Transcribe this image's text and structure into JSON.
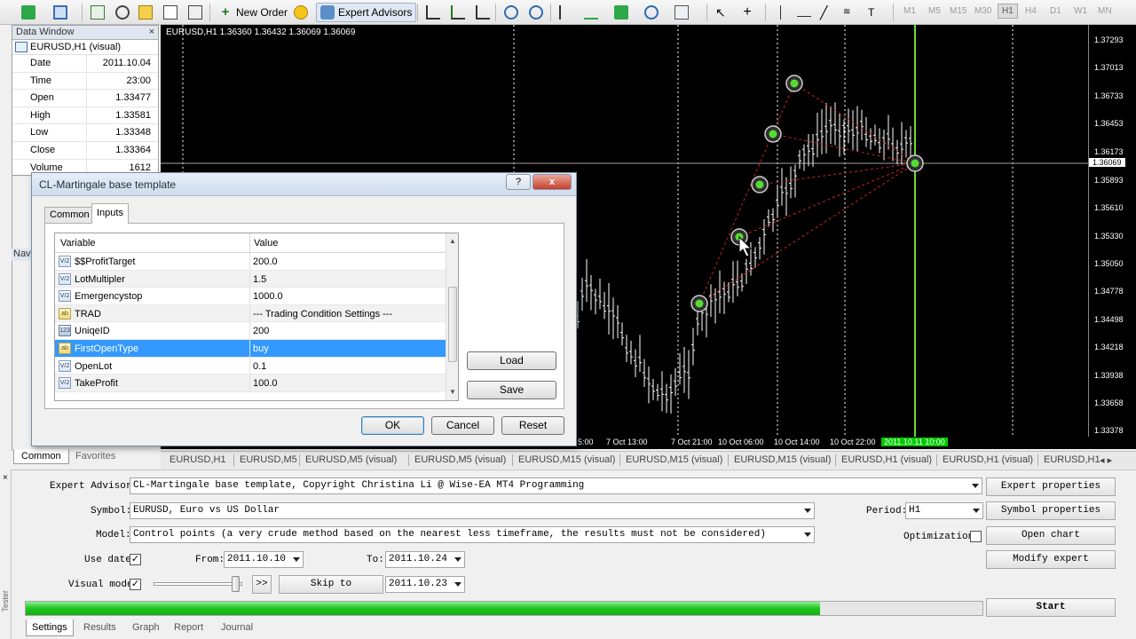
{
  "colors": {
    "chart_bg": "#000000",
    "candle": "#ffffff",
    "green_line": "#66dd33",
    "arrow_line": "#cc2222",
    "selection": "#3399ff",
    "progress": "#22c322"
  },
  "toolbar": {
    "new_order": "New Order",
    "expert_advisors": "Expert Advisors",
    "timeframes": [
      "M1",
      "M5",
      "M15",
      "M30",
      "H1",
      "H4",
      "D1",
      "W1",
      "MN"
    ],
    "active_timeframe": "H1"
  },
  "data_window": {
    "title": "Data Window",
    "close": "×",
    "symbol": "EURUSD,H1 (visual)",
    "rows": [
      {
        "k": "Date",
        "v": "2011.10.04"
      },
      {
        "k": "Time",
        "v": "23:00"
      },
      {
        "k": "Open",
        "v": "1.33477"
      },
      {
        "k": "High",
        "v": "1.33581"
      },
      {
        "k": "Low",
        "v": "1.33348"
      },
      {
        "k": "Close",
        "v": "1.33364"
      },
      {
        "k": "Volume",
        "v": "1612"
      }
    ],
    "navigator_stub": "Nav",
    "tabs": [
      "Common",
      "Favorites"
    ]
  },
  "chart": {
    "label": "EURUSD,H1  1.36360 1.36432 1.36069 1.36069",
    "price_labels": [
      "1.37293",
      "1.37013",
      "1.36733",
      "1.36453",
      "1.36173",
      "1.36069",
      "1.35893",
      "1.35610",
      "1.35330",
      "1.35050",
      "1.34778",
      "1.34498",
      "1.34218",
      "1.33938",
      "1.33658",
      "1.33378"
    ],
    "current_price": "1.36069",
    "time_labels": [
      "5:00",
      "7 Oct 13:00",
      "7 Oct 21:00",
      "10 Oct 06:00",
      "10 Oct 14:00",
      "10 Oct 22:00",
      "2011.10.11 10:00"
    ],
    "tabs": [
      "EURUSD,H1",
      "EURUSD,M5",
      "EURUSD,M5 (visual)",
      "EURUSD,M5 (visual)",
      "EURUSD,M15 (visual)",
      "EURUSD,M15 (visual)",
      "EURUSD,M15 (visual)",
      "EURUSD,H1 (visual)",
      "EURUSD,H1 (visual)",
      "EURUSD,H1"
    ]
  },
  "dialog": {
    "title": "CL-Martingale base template",
    "help_btn": "?",
    "close_btn": "x",
    "tabs": [
      "Common",
      "Inputs"
    ],
    "active_tab": "Inputs",
    "columns": [
      "Variable",
      "Value"
    ],
    "rows": [
      {
        "icon": "V/2",
        "type": "v",
        "name": "$$ProfitTarget",
        "value": "200.0"
      },
      {
        "icon": "V/2",
        "type": "v",
        "name": "LotMultipler",
        "value": "1.5"
      },
      {
        "icon": "V/2",
        "type": "v",
        "name": "Emergencystop",
        "value": "1000.0"
      },
      {
        "icon": "ab",
        "type": "ab",
        "name": "TRAD",
        "value": "--- Trading Condition Settings ---"
      },
      {
        "icon": "123",
        "type": "n",
        "name": "UniqeID",
        "value": "200"
      },
      {
        "icon": "ab",
        "type": "ab",
        "name": "FirstOpenType",
        "value": "buy",
        "selected": true
      },
      {
        "icon": "V/2",
        "type": "v",
        "name": "OpenLot",
        "value": "0.1"
      },
      {
        "icon": "V/2",
        "type": "v",
        "name": "TakeProfit",
        "value": "100.0"
      }
    ],
    "load": "Load",
    "save": "Save",
    "ok": "OK",
    "cancel": "Cancel",
    "reset": "Reset"
  },
  "tester": {
    "side_label": "Tester",
    "expert_label": "Expert Advisor:",
    "expert_value": "CL-Martingale base template, Copyright Christina Li @ Wise-EA MT4 Programming",
    "symbol_label": "Symbol:",
    "symbol_value": "EURUSD, Euro vs US Dollar",
    "model_label": "Model:",
    "model_value": "Control points (a very crude method based on the nearest less timeframe, the results must not be considered)",
    "use_date_label": "Use date",
    "from_label": "From:",
    "from_value": "2011.10.10",
    "to_label": "To:",
    "to_value": "2011.10.24",
    "visual_label": "Visual mode",
    "ff_btn": ">>",
    "skip_btn": "Skip to",
    "skip_value": "2011.10.23",
    "period_label": "Period:",
    "period_value": "H1",
    "optimization_label": "Optimization",
    "expert_props": "Expert properties",
    "symbol_props": "Symbol properties",
    "open_chart": "Open chart",
    "modify_expert": "Modify expert",
    "start": "Start",
    "progress_pct": 83,
    "check": "✓",
    "tabs": [
      "Settings",
      "Results",
      "Graph",
      "Report",
      "Journal"
    ],
    "active_tab": "Settings"
  }
}
